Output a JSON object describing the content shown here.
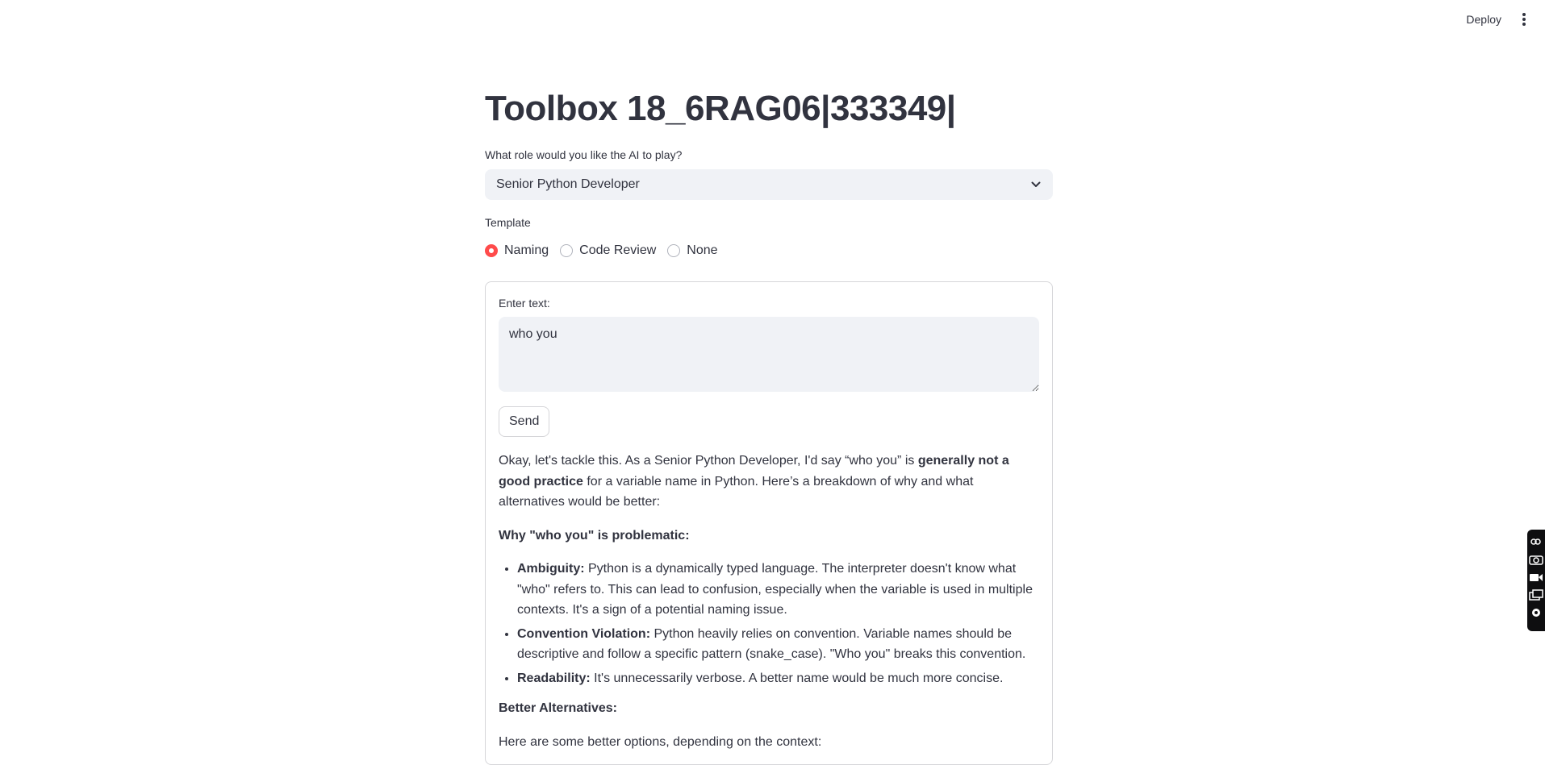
{
  "header": {
    "deploy_label": "Deploy"
  },
  "page": {
    "title": "Toolbox 18_6RAG06|333349|"
  },
  "role": {
    "label": "What role would you like the AI to play?",
    "selected": "Senior Python Developer"
  },
  "template": {
    "label": "Template",
    "options": [
      "Naming",
      "Code Review",
      "None"
    ],
    "selected": "Naming"
  },
  "form": {
    "input_label": "Enter text:",
    "input_value": "who you",
    "send_label": "Send"
  },
  "response": {
    "intro_pre": "Okay, let's tackle this. As a Senior Python Developer, I'd say “who you” is ",
    "intro_bold": "generally not a good practice",
    "intro_post": " for a variable name in Python. Here’s a breakdown of why and what alternatives would be better:",
    "why_heading": "Why \"who you\" is problematic:",
    "points": [
      {
        "term": "Ambiguity:",
        "text": " Python is a dynamically typed language. The interpreter doesn't know what \"who\" refers to. This can lead to confusion, especially when the variable is used in multiple contexts. It's a sign of a potential naming issue."
      },
      {
        "term": "Convention Violation:",
        "text": " Python heavily relies on convention. Variable names should be descriptive and follow a specific pattern (snake_case). \"Who you\" breaks this convention."
      },
      {
        "term": "Readability:",
        "text": " It's unnecessarily verbose. A better name would be much more concise."
      }
    ],
    "alt_heading": "Better Alternatives:",
    "alt_intro": "Here are some better options, depending on the context:"
  },
  "colors": {
    "accent": "#ff4b4b",
    "text": "#31333f",
    "input_bg": "#f0f2f6"
  }
}
